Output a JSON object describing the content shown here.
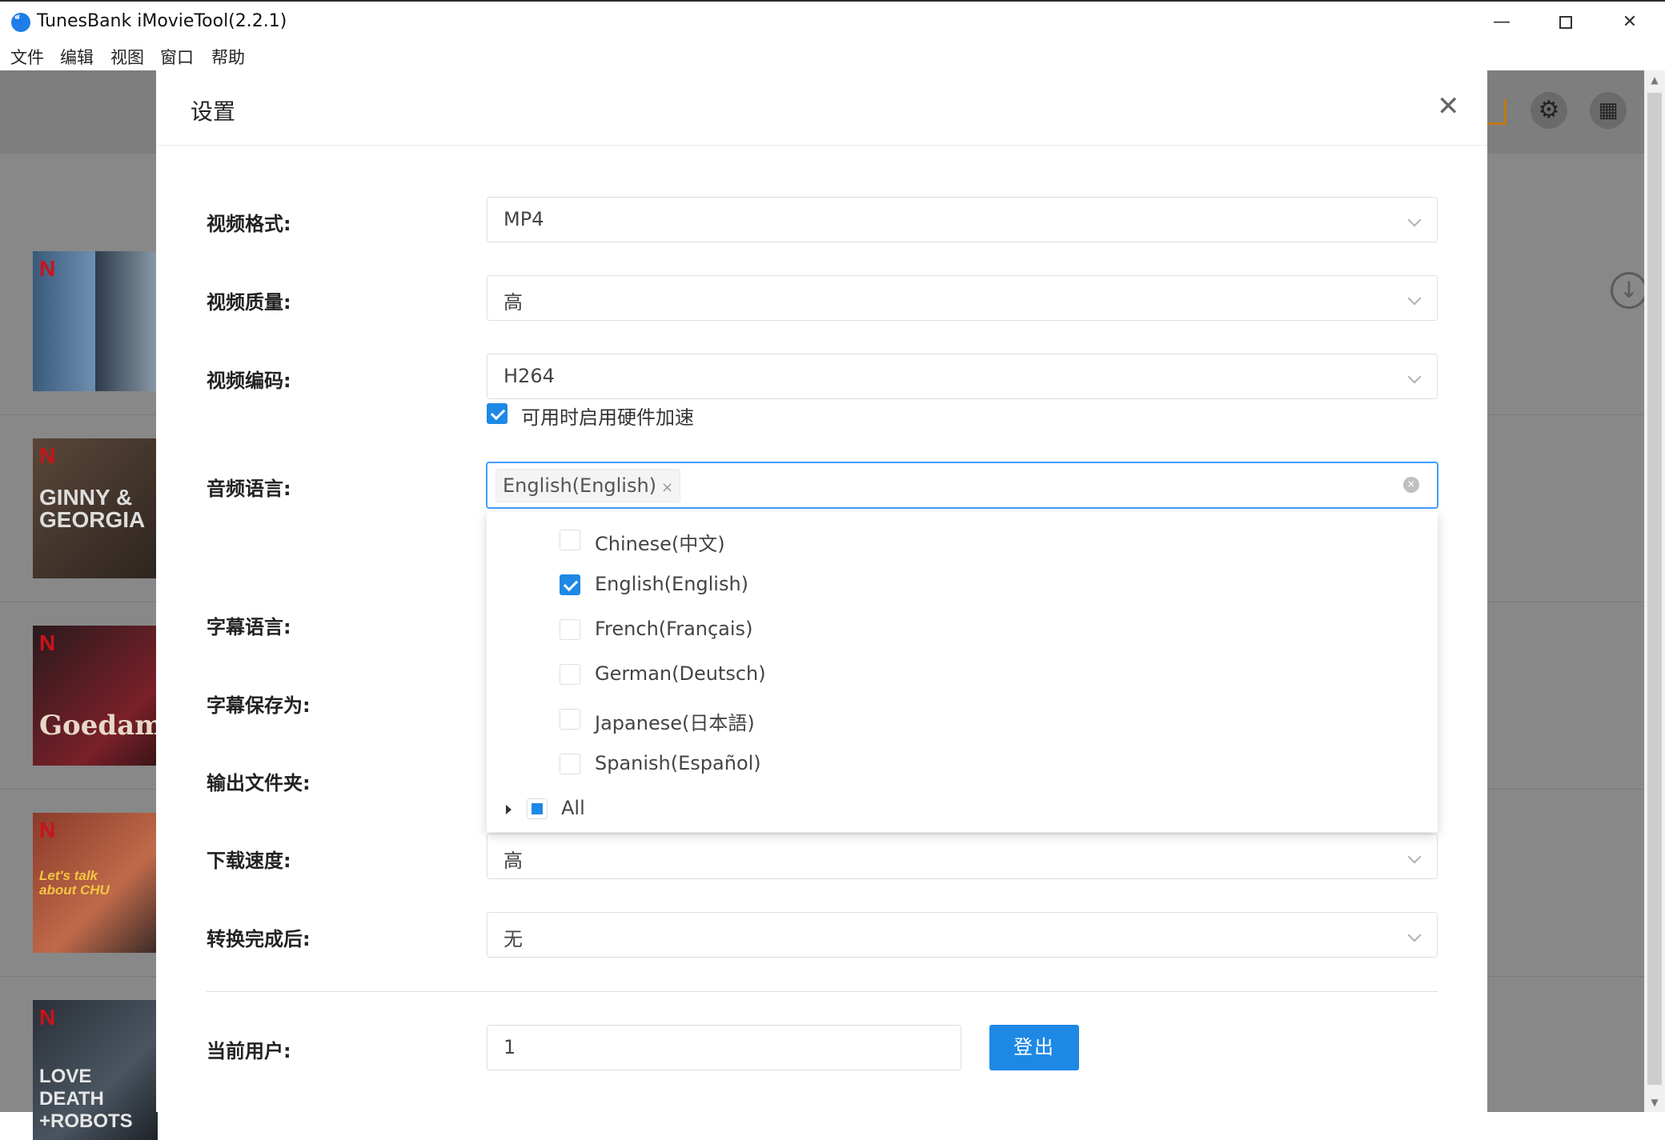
{
  "window": {
    "title": "TunesBank iMovieTool(2.2.1)",
    "logo_glyph": "็",
    "min_glyph": "—",
    "close_glyph": "✕"
  },
  "menu": [
    "文件",
    "编辑",
    "视图",
    "窗口",
    "帮助"
  ],
  "background": {
    "thumbnails": [
      {
        "title": "",
        "logo": "N"
      },
      {
        "title": "GINNY & GEORGIA",
        "logo": "N"
      },
      {
        "title": "Goedam",
        "logo": "N"
      },
      {
        "title": "Let's talk about CHU",
        "logo": "N"
      },
      {
        "title": "LOVE DEATH +ROBOTS",
        "logo": "N"
      }
    ]
  },
  "dialog": {
    "title": "设置",
    "close_glyph": "✕",
    "fields": {
      "video_format": {
        "label": "视频格式:",
        "value": "MP4"
      },
      "video_quality": {
        "label": "视频质量:",
        "value": "高"
      },
      "video_codec": {
        "label": "视频编码:",
        "value": "H264"
      },
      "hw_accel": {
        "label": "可用时启用硬件加速",
        "checked": true
      },
      "audio_language": {
        "label": "音频语言:",
        "selected_tag": "English(English)",
        "tag_remove": "×",
        "clear_glyph": "×"
      },
      "subtitle_language": {
        "label": "字幕语言:"
      },
      "subtitle_save_as": {
        "label": "字幕保存为:"
      },
      "output_folder": {
        "label": "输出文件夹:"
      },
      "download_speed": {
        "label": "下载速度:",
        "value": "高"
      },
      "after_convert": {
        "label": "转换完成后:",
        "value": "无"
      },
      "current_user": {
        "label": "当前用户:",
        "value": "1"
      }
    },
    "logout_label": "登出",
    "audio_options": [
      {
        "label": "Chinese(中文)",
        "checked": false
      },
      {
        "label": "English(English)",
        "checked": true
      },
      {
        "label": "French(Français)",
        "checked": false
      },
      {
        "label": "German(Deutsch)",
        "checked": false
      },
      {
        "label": "Japanese(日本語)",
        "checked": false
      },
      {
        "label": "Spanish(Español)",
        "checked": false
      }
    ],
    "audio_all_label": "All"
  },
  "colors": {
    "accent": "#1e88e5",
    "netflix_red": "#c8141b",
    "overlay": "#8c8c8c"
  }
}
